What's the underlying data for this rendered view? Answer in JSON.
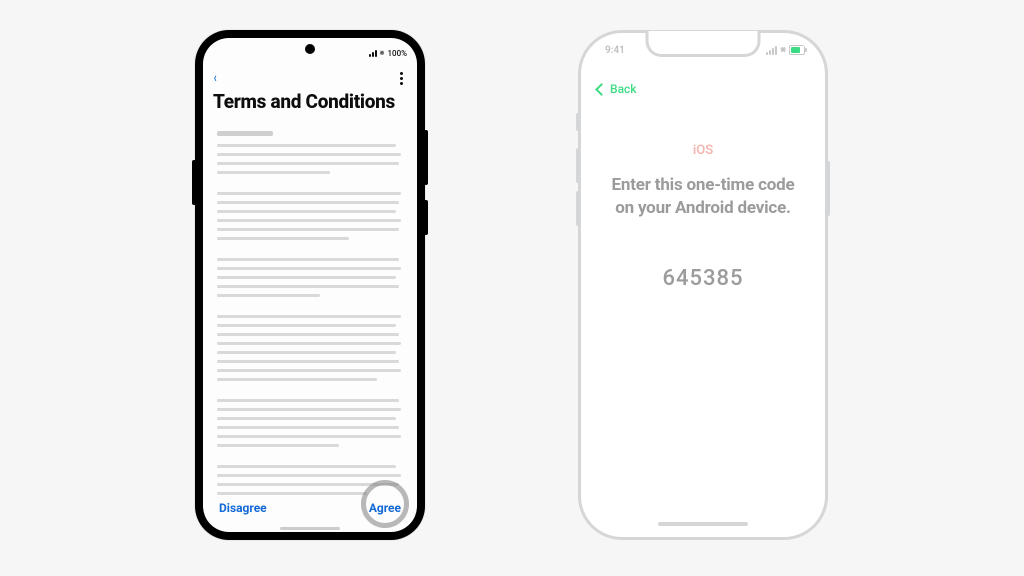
{
  "android": {
    "status": {
      "time_placeholder": "",
      "battery_text": "100%"
    },
    "title": "Terms and Conditions",
    "footer": {
      "disagree_label": "Disagree",
      "agree_label": "Agree"
    }
  },
  "iphone": {
    "status": {
      "time": "9:41"
    },
    "nav": {
      "back_label": "Back"
    },
    "os_label": "iOS",
    "prompt_text": "Enter this one-time code on your Android device.",
    "code": "645385"
  }
}
